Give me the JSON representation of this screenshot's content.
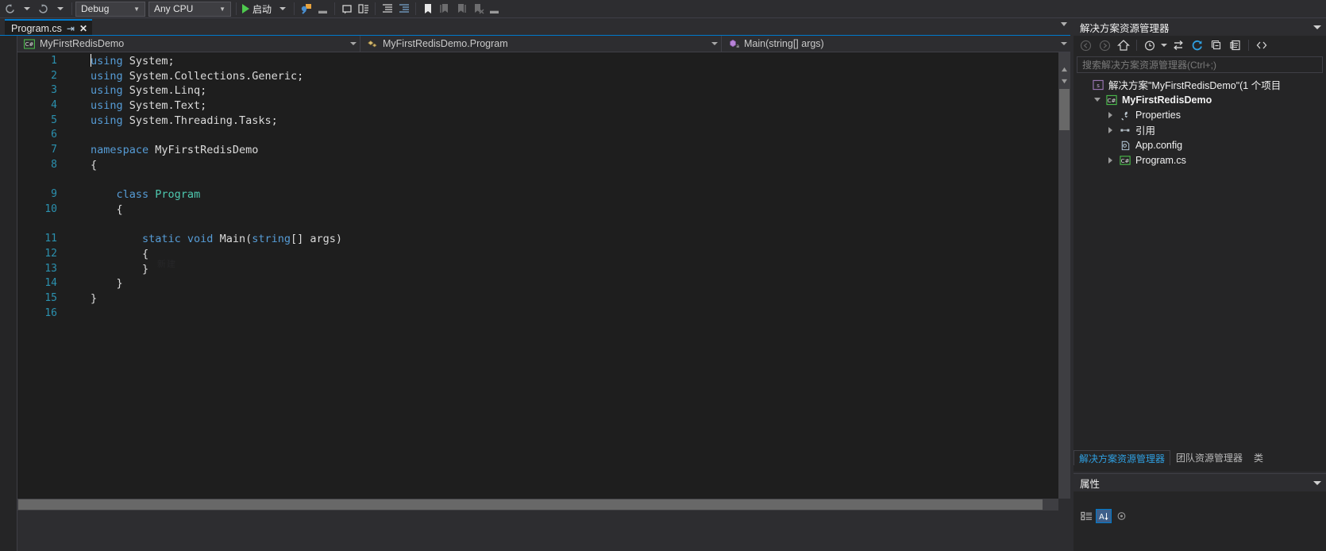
{
  "toolbar": {
    "nav_back": "navigate-back",
    "nav_forward": "navigate-forward",
    "config_value": "Debug",
    "platform_value": "Any CPU",
    "run_label": "启动",
    "icons": [
      "undo-icon",
      "redo-icon",
      "attach-to-process-icon",
      "comment-icon",
      "uncomment-icon",
      "indent-icon",
      "outdent-icon",
      "bookmark-icon",
      "prev-bookmark-icon",
      "next-bookmark-icon",
      "clear-bookmarks-icon"
    ]
  },
  "tabs": {
    "active": "Program.cs",
    "pin_icon": "pin-icon",
    "close_icon": "close-icon"
  },
  "navbar": {
    "project": "MyFirstRedisDemo",
    "type": "MyFirstRedisDemo.Program",
    "member": "Main(string[] args)",
    "project_icon": "csharp-project-icon",
    "type_icon": "class-icon",
    "member_icon": "method-icon"
  },
  "editor": {
    "watermark": "新建",
    "lines": [
      {
        "n": "1",
        "tokens": [
          {
            "t": "using ",
            "c": "k"
          },
          {
            "t": "System;",
            "c": "p"
          }
        ]
      },
      {
        "n": "2",
        "tokens": [
          {
            "t": "using ",
            "c": "k"
          },
          {
            "t": "System.Collections.Generic;",
            "c": "p"
          }
        ]
      },
      {
        "n": "3",
        "tokens": [
          {
            "t": "using ",
            "c": "k"
          },
          {
            "t": "System.Linq;",
            "c": "p"
          }
        ]
      },
      {
        "n": "4",
        "tokens": [
          {
            "t": "using ",
            "c": "k"
          },
          {
            "t": "System.Text;",
            "c": "p"
          }
        ]
      },
      {
        "n": "5",
        "tokens": [
          {
            "t": "using ",
            "c": "k"
          },
          {
            "t": "System.Threading.Tasks;",
            "c": "p"
          }
        ]
      },
      {
        "n": "6",
        "tokens": []
      },
      {
        "n": "7",
        "tokens": [
          {
            "t": "namespace ",
            "c": "k"
          },
          {
            "t": "MyFirstRedisDemo",
            "c": "p"
          }
        ]
      },
      {
        "n": "8",
        "tokens": [
          {
            "t": "{",
            "c": "p"
          }
        ]
      },
      {
        "n": "",
        "tokens": []
      },
      {
        "n": "9",
        "tokens": [
          {
            "t": "    ",
            "c": "p"
          },
          {
            "t": "class ",
            "c": "k"
          },
          {
            "t": "Program",
            "c": "t"
          }
        ]
      },
      {
        "n": "10",
        "tokens": [
          {
            "t": "    {",
            "c": "p"
          }
        ]
      },
      {
        "n": "",
        "tokens": []
      },
      {
        "n": "11",
        "tokens": [
          {
            "t": "        ",
            "c": "p"
          },
          {
            "t": "static void ",
            "c": "k"
          },
          {
            "t": "Main(",
            "c": "p"
          },
          {
            "t": "string",
            "c": "k"
          },
          {
            "t": "[] args)",
            "c": "p"
          }
        ]
      },
      {
        "n": "12",
        "tokens": [
          {
            "t": "        {",
            "c": "p"
          }
        ]
      },
      {
        "n": "13",
        "tokens": [
          {
            "t": "        }",
            "c": "p"
          }
        ]
      },
      {
        "n": "14",
        "tokens": [
          {
            "t": "    }",
            "c": "p"
          }
        ]
      },
      {
        "n": "15",
        "tokens": [
          {
            "t": "}",
            "c": "p"
          }
        ]
      },
      {
        "n": "16",
        "tokens": []
      }
    ]
  },
  "solution_explorer": {
    "title": "解决方案资源管理器",
    "search_placeholder": "搜索解决方案资源管理器(Ctrl+;)",
    "toolbar_icons": [
      "back-icon",
      "forward-icon",
      "home-icon",
      "pending-changes-icon",
      "sync-with-active-document-icon",
      "refresh-icon",
      "collapse-all-icon",
      "properties-window-icon",
      "show-all-files-icon"
    ],
    "tree": [
      {
        "label": "解决方案\"MyFirstRedisDemo\"(1 个项目",
        "indent": 0,
        "expander": "none",
        "icon": "solution-icon",
        "bold": false
      },
      {
        "label": "MyFirstRedisDemo",
        "indent": 1,
        "expander": "down",
        "icon": "csharp-project-icon",
        "bold": true
      },
      {
        "label": "Properties",
        "indent": 2,
        "expander": "right",
        "icon": "wrench-icon",
        "bold": false
      },
      {
        "label": "引用",
        "indent": 2,
        "expander": "right",
        "icon": "references-icon",
        "bold": false
      },
      {
        "label": "App.config",
        "indent": 2,
        "expander": "none",
        "icon": "config-file-icon",
        "bold": false
      },
      {
        "label": "Program.cs",
        "indent": 2,
        "expander": "right",
        "icon": "csharp-file-icon",
        "bold": false
      }
    ],
    "bottom_tabs": [
      {
        "label": "解决方案资源管理器",
        "active": true
      },
      {
        "label": "团队资源管理器",
        "active": false
      },
      {
        "label": "类",
        "active": false
      }
    ]
  },
  "properties": {
    "title": "属性",
    "toolbar_icons": [
      "categorized-icon",
      "alphabetical-icon",
      "properties-icon"
    ]
  },
  "colors": {
    "accent": "#007acc",
    "editor_bg": "#1e1e1e",
    "chrome_bg": "#2d2d30",
    "panel_bg": "#252526",
    "keyword": "#569cd6",
    "type": "#4ec9b0",
    "linenum": "#2b91af",
    "text": "#dcdcdc"
  }
}
